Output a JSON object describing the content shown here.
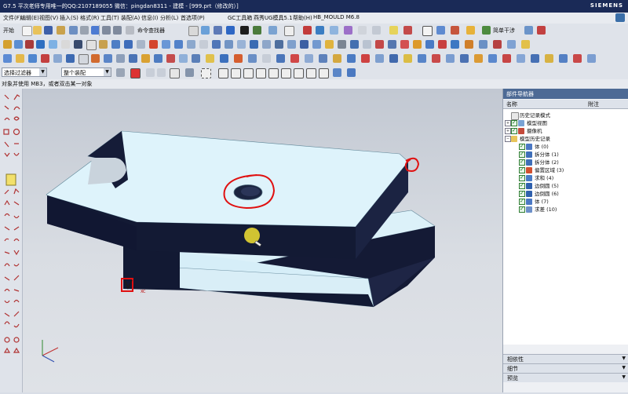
{
  "window": {
    "title": "G7.5 平次老师专用唯一的QQ:2107189055  微信：pingdan8311 - 建模 - [999.prt（修改的）]",
    "brand": "SIEMENS"
  },
  "menu": [
    "文件(F)",
    "编辑(E)",
    "视图(V)",
    "插入(S)",
    "格式(R)",
    "工具(T)",
    "装配(A)",
    "信息(I)",
    "分析(L)",
    "首选项(P)",
    "GC工具箱",
    "燕秀UG模具5.1",
    "帮助(H)",
    "HB_MOULD M6.8"
  ],
  "toolbar1": {
    "start_label": "开始",
    "command_finder_label": "命令查找器",
    "simple_gap_label": "简单干涉"
  },
  "filterbar": {
    "selection_filter": "选择过滤器",
    "assembly_scope": "整个装配"
  },
  "cue_line": "对象并使用 MB3，或者双击某一对象",
  "navigator": {
    "title": "部件导航器",
    "col_name": "名称",
    "col_note": "附注",
    "items": [
      {
        "label": "历史记录模式"
      },
      {
        "label": "模型视图"
      },
      {
        "label": "摄像机"
      },
      {
        "label": "模型历史记录"
      },
      {
        "label": "体 (0)"
      },
      {
        "label": "拆分体 (1)"
      },
      {
        "label": "拆分体 (2)"
      },
      {
        "label": "偏置区域 (3)"
      },
      {
        "label": "求和 (4)"
      },
      {
        "label": "边倒圆 (5)"
      },
      {
        "label": "边倒圆 (6)"
      },
      {
        "label": "体 (7)"
      },
      {
        "label": "求差 (10)"
      }
    ],
    "panels": [
      "相依性",
      "细节",
      "预览"
    ]
  },
  "viewport": {
    "vertex_label": "XC"
  },
  "colors": {
    "annotation": "#e01010",
    "face_top": "#dff3fa",
    "face_side": "#121933",
    "highlight": "#f3e232"
  }
}
